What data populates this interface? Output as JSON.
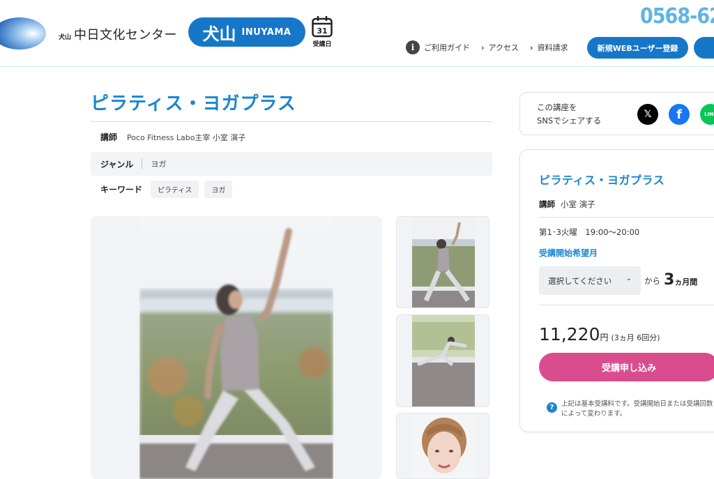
{
  "header": {
    "logo_small": "犬山",
    "logo_name": "中日文化センター",
    "branch_kanji": "犬山",
    "branch_en": "INUYAMA",
    "calendar_day": "31",
    "calendar_label": "受講日",
    "phone": "0568-62",
    "nav": {
      "guide": "ご利用ガイド",
      "access": "アクセス",
      "request": "資料請求"
    },
    "register_button": "新規WEBユーザー登録"
  },
  "course": {
    "title": "ピラティス・ヨガプラス",
    "teacher_label": "講師",
    "teacher_value": "Poco Fitness Labo主宰 小室 演子",
    "genre_label": "ジャンル",
    "genre_value": "ヨガ",
    "keyword_label": "キーワード",
    "keywords": [
      "ピラティス",
      "ヨガ"
    ]
  },
  "share": {
    "line1": "この講座を",
    "line2": "SNSでシェアする",
    "x_label": "𝕏",
    "fb_label": "f",
    "line_label": "LINE"
  },
  "order": {
    "title": "ピラティス・ヨガプラス",
    "teacher_label": "講師",
    "teacher_value": "小室 演子",
    "schedule": "第1･3火曜　19:00〜20:00",
    "start_label": "受講開始希望月",
    "select_placeholder": "選択してください",
    "from_text": "から",
    "months_num": "3",
    "months_unit": "ヵ月間",
    "price": "11,220",
    "price_unit": "円",
    "price_detail": "(3ヵ月 6回分)",
    "apply_button": "受講申し込み",
    "note": "上記は基本受講料です。受講開始日または受講回数によって変わります。"
  },
  "colors": {
    "brand_blue": "#1677c9",
    "title_blue": "#1a86cf",
    "apply_pink": "#d94d8f"
  }
}
